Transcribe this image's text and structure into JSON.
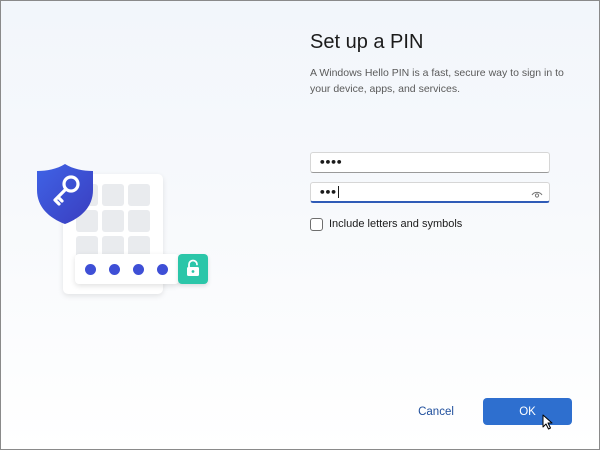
{
  "page": {
    "title": "Set up a PIN",
    "description": "A Windows Hello PIN is a fast, secure way to sign in to your device, apps, and services."
  },
  "form": {
    "pin_value": "••••",
    "confirm_value": "•••",
    "reveal_icon": "eye-icon",
    "include_letters_label": "Include letters and symbols",
    "include_letters_checked": false
  },
  "buttons": {
    "cancel_label": "Cancel",
    "ok_label": "OK"
  },
  "illustration": {
    "pin_dots_filled": 4,
    "icons": [
      "shield-key-icon",
      "unlock-icon"
    ]
  },
  "colors": {
    "accent": "#2e6fcf",
    "shield": "#3b4bd1",
    "unlock_tile": "#2bc6a9",
    "link": "#1f4e9c"
  }
}
